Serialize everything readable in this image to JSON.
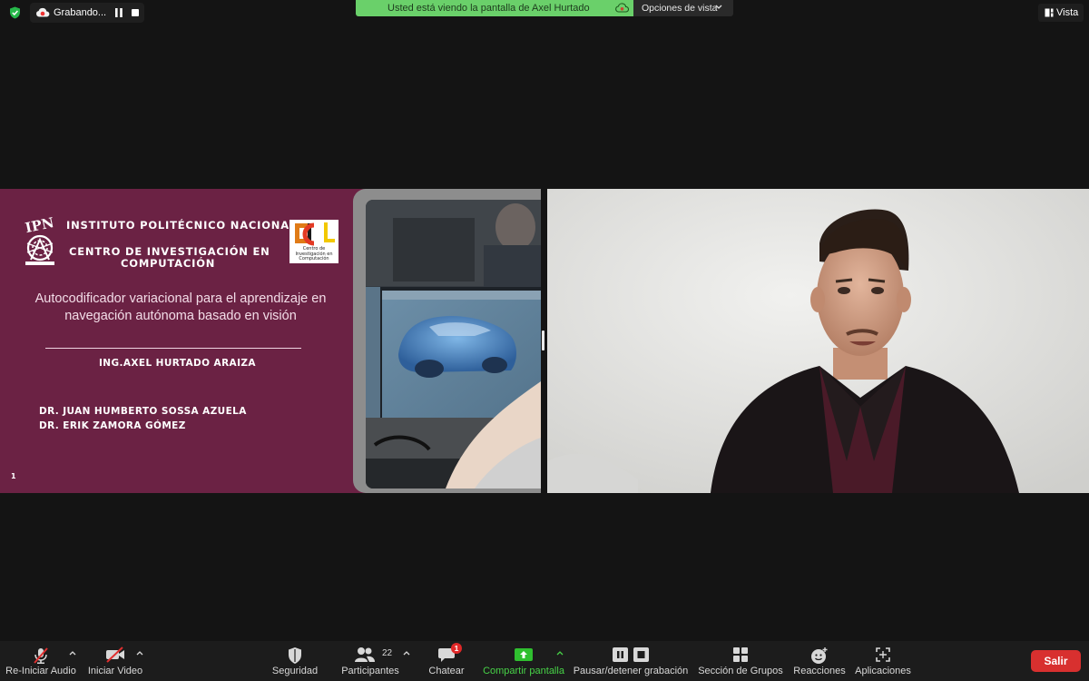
{
  "top_bar": {
    "recording_label": "Grabando...",
    "share_banner": "Usted está viendo la pantalla de Axel Hurtado",
    "view_options": "Opciones de vista",
    "view_button": "Vista"
  },
  "slide": {
    "institute": "INSTITUTO POLITÉCNICO NACIONAL",
    "center_line1": "CENTRO DE INVESTIGACIÓN EN",
    "center_line2": "COMPUTACIÓN",
    "logo_caption": "Centro de Investigación en Computación",
    "title_line1": "Autocodificador variacional para el aprendizaje en",
    "title_line2": "navegación autónoma basado en visión",
    "author": "ING.AXEL HURTADO ARAIZA",
    "advisor1": "DR. JUAN HUMBERTO SOSSA AZUELA",
    "advisor2": "DR. ERIK ZAMORA GÓMEZ",
    "page_number": "1",
    "background_color": "#6b2244"
  },
  "toolbar": {
    "audio": "Re-Iniciar Audio",
    "video": "Iniciar Video",
    "security": "Seguridad",
    "participants": "Participantes",
    "participants_count": "22",
    "chat": "Chatear",
    "chat_badge": "1",
    "share": "Compartir pantalla",
    "pause_record": "Pausar/detener grabación",
    "breakout": "Sección de Grupos",
    "reactions": "Reacciones",
    "apps": "Aplicaciones",
    "leave": "Salir",
    "share_color": "#47d247",
    "leave_color": "#d8302f"
  }
}
